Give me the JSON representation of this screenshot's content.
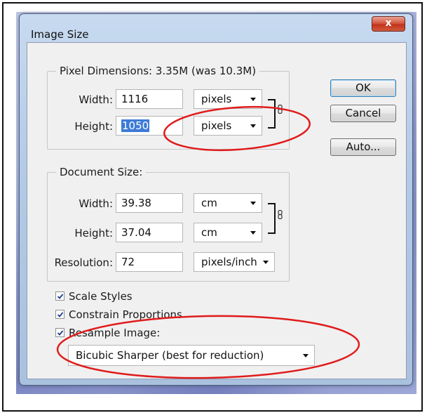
{
  "dialog": {
    "title": "Image Size",
    "close_glyph": "x"
  },
  "pixel_dimensions": {
    "label": "Pixel Dimensions:",
    "size_text": "3.35M (was 10.3M)",
    "width_label": "Width:",
    "width_value": "1116",
    "width_unit": "pixels",
    "height_label": "Height:",
    "height_value": "1050",
    "height_unit": "pixels"
  },
  "document_size": {
    "label": "Document Size:",
    "width_label": "Width:",
    "width_value": "39.38",
    "width_unit": "cm",
    "height_label": "Height:",
    "height_value": "37.04",
    "height_unit": "cm",
    "resolution_label": "Resolution:",
    "resolution_value": "72",
    "resolution_unit": "pixels/inch"
  },
  "buttons": {
    "ok": "OK",
    "cancel": "Cancel",
    "auto": "Auto..."
  },
  "options": {
    "scale_styles": "Scale Styles",
    "scale_styles_checked": true,
    "constrain_proportions": "Constrain Proportions",
    "constrain_proportions_checked": true,
    "resample_image": "Resample Image:",
    "resample_image_checked": true,
    "resample_method": "Bicubic Sharper (best for reduction)"
  },
  "colors": {
    "annotation": "#e01b1b",
    "selection": "#3d7bd6",
    "window_frame": "#b4cbe6",
    "close_button": "#c2331c"
  },
  "icons": [
    "close-icon",
    "chain-link-icon",
    "dropdown-arrow-icon",
    "checkmark-icon"
  ]
}
